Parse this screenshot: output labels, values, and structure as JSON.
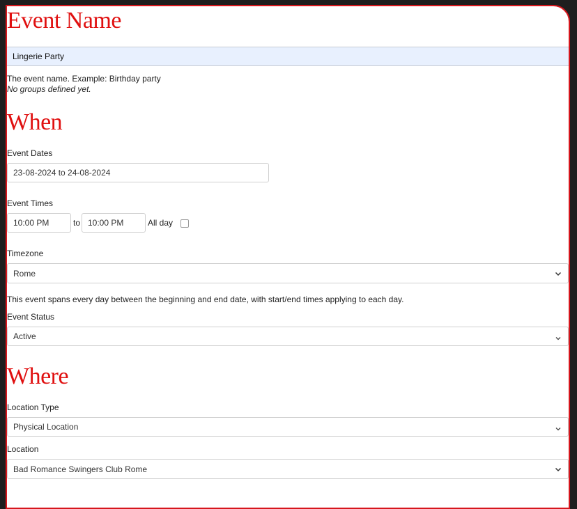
{
  "event_name": {
    "title": "Event Name",
    "value": "Lingerie Party",
    "help": "The event name. Example: Birthday party",
    "groups_note": "No groups defined yet."
  },
  "when": {
    "title": "When",
    "dates_label": "Event Dates",
    "dates_value": "23-08-2024 to 24-08-2024",
    "times_label": "Event Times",
    "start_time": "10:00 PM",
    "to_label": "to",
    "end_time": "10:00 PM",
    "all_day_label": "All day",
    "all_day_checked": false,
    "timezone_label": "Timezone",
    "timezone_value": "Rome",
    "span_note": "This event spans every day between the beginning and end date, with start/end times applying to each day.",
    "status_label": "Event Status",
    "status_value": "Active"
  },
  "where": {
    "title": "Where",
    "location_type_label": "Location Type",
    "location_type_value": "Physical Location",
    "location_label": "Location",
    "location_value": "Bad Romance Swingers Club Rome"
  },
  "colors": {
    "accent": "#e01010",
    "panel_border": "#d6161c",
    "autofill_bg": "#e8f0fe"
  },
  "icons": {
    "select_arrow": "chevron-down-icon"
  }
}
